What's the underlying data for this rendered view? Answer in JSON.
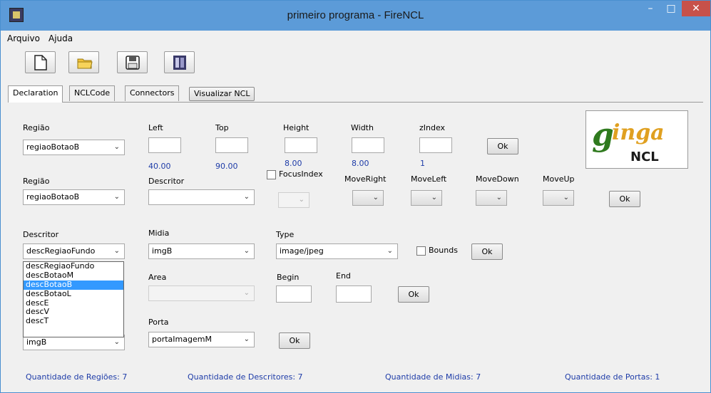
{
  "window": {
    "title": "primeiro programa - FireNCL"
  },
  "menu": [
    "Arquivo",
    "Ajuda"
  ],
  "toolbar_icons": [
    "new-file-icon",
    "open-folder-icon",
    "save-icon",
    "app-logo-icon"
  ],
  "tabs": {
    "declaration": "Declaration",
    "nclcode": "NCLCode",
    "connectors": "Connectors",
    "visualizar": "Visualizar NCL"
  },
  "row1": {
    "regiao_label": "Região",
    "regiao_value": "regiaoBotaoB",
    "left_label": "Left",
    "left_value": "40.00",
    "top_label": "Top",
    "top_value": "90.00",
    "height_label": "Height",
    "height_value": "8.00",
    "width_label": "Width",
    "width_value": "8.00",
    "zindex_label": "zIndex",
    "zindex_value": "1",
    "ok": "Ok"
  },
  "row2": {
    "regiao_label": "Região",
    "regiao_value": "regiaoBotaoB",
    "descritor_label": "Descritor",
    "descritor_value": "",
    "focusindex_label": "FocusIndex",
    "moveright_label": "MoveRight",
    "moveleft_label": "MoveLeft",
    "movedown_label": "MoveDown",
    "moveup_label": "MoveUp",
    "ok": "Ok"
  },
  "row3": {
    "descritor_label": "Descritor",
    "descritor_value": "descRegiaoFundo",
    "midia_label": "Midia",
    "midia_value": "imgB",
    "type_label": "Type",
    "type_value": "image/jpeg",
    "bounds_label": "Bounds",
    "ok": "Ok"
  },
  "dropdown_items": [
    "descRegiaoFundo",
    "descBotaoM",
    "descBotaoB",
    "descBotaoL",
    "descE",
    "descV",
    "descT"
  ],
  "dropdown_selected_index": 2,
  "row4": {
    "area_label": "Area",
    "begin_label": "Begin",
    "end_label": "End",
    "ok": "Ok"
  },
  "row5": {
    "midia_value": "imgB",
    "porta_label": "Porta",
    "porta_value": "portaImagemM",
    "ok": "Ok"
  },
  "logo": {
    "text_top": "inga",
    "text_bottom": "NCL"
  },
  "status": {
    "regioes": "Quantidade de Regiões:  7",
    "descritores": "Quantidade de Descritores: 7",
    "midias": "Quantidade de Midias: 7",
    "portas": "Quantidade de Portas:    1"
  },
  "colors": {
    "titlebar": "#5c9bd8",
    "close": "#c7514a",
    "accent_text": "#1e3ca8",
    "selection": "#3399ff"
  }
}
